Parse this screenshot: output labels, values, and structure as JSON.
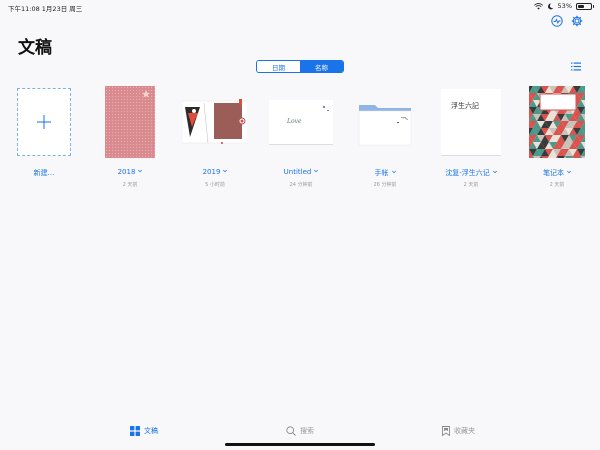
{
  "status": {
    "time": "下午11:08  1月23日 周三",
    "battery": "53%",
    "battery_level": 0.53
  },
  "header": {
    "title": "文稿"
  },
  "segment": {
    "date": "日期",
    "name": "名称",
    "selected": "name"
  },
  "documents": [
    {
      "title": "新建...",
      "subtitle": "",
      "chevron": false
    },
    {
      "title": "2018",
      "subtitle": "2 天前",
      "chevron": true
    },
    {
      "title": "2019",
      "subtitle": "5 小时前",
      "chevron": true
    },
    {
      "title": "Untitled",
      "subtitle": "24 分钟前",
      "chevron": true
    },
    {
      "title": "手帐",
      "subtitle": "26 分钟前",
      "chevron": true
    },
    {
      "title": "沈复-浮生六记",
      "subtitle": "2 天前",
      "chevron": true
    },
    {
      "title": "笔记本",
      "subtitle": "2 天前",
      "chevron": true
    }
  ],
  "thumbnails": {
    "untitled_text": "Love",
    "fusheng_text": "浮生六記"
  },
  "tabs": [
    {
      "label": "文稿",
      "icon": "grid-icon",
      "active": true
    },
    {
      "label": "搜索",
      "icon": "search-icon",
      "active": false
    },
    {
      "label": "收藏夹",
      "icon": "bookmark-icon",
      "active": false
    }
  ],
  "colors": {
    "accent": "#1a73e8",
    "pink_cover": "#d98a8f",
    "brown_cover": "#9c5d58",
    "folder": "#8fb4e6",
    "triangle_red": "#d9534f",
    "triangle_teal": "#4a9a8c",
    "triangle_dark": "#3a3a3a"
  }
}
